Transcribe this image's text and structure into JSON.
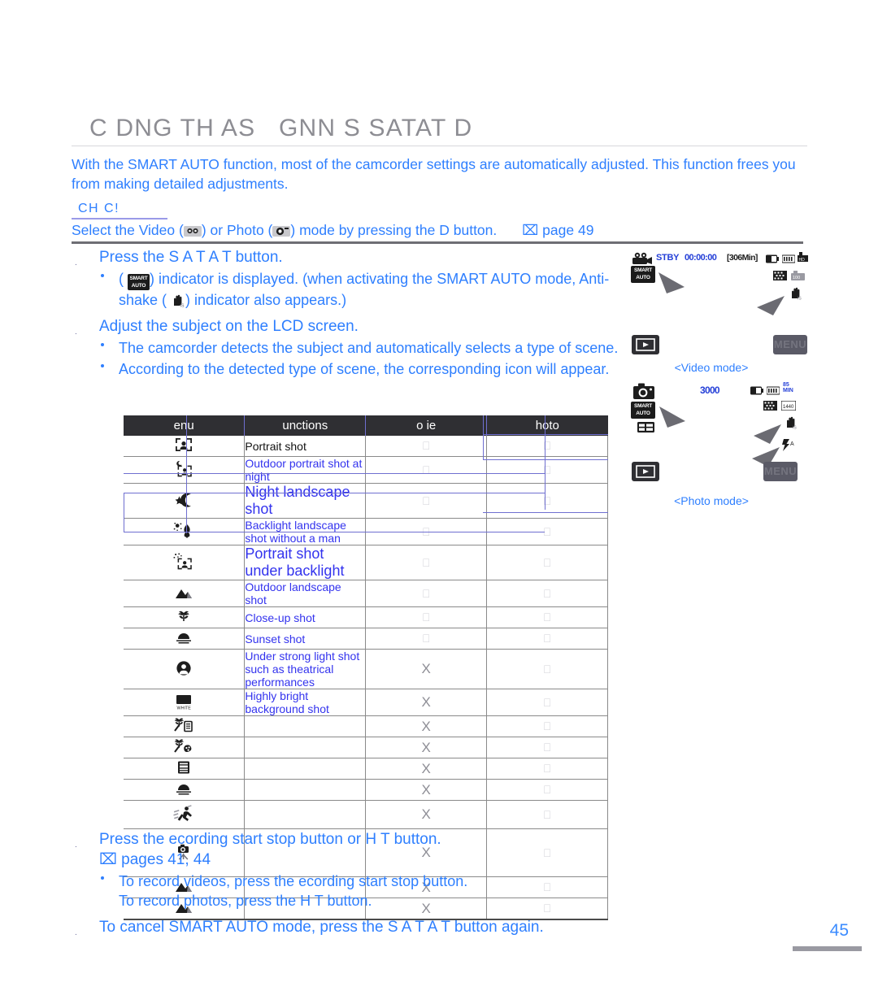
{
  "document": {
    "title": "C DNG TH AS   GNN S SATAT D",
    "page_number": "45"
  },
  "intro": {
    "paragraph": "With the SMART AUTO function, most of the camcorder settings are automatically adjusted. This function frees you from making detailed adjustments."
  },
  "check_box": {
    "label": "CH C!",
    "line_part1": "Select the Video (",
    "line_part2": ") or Photo (",
    "line_part3": ") mode by pressing the  D  button.",
    "page_ref": "⌧ page 49"
  },
  "steps": [
    {
      "num": ".",
      "text": "Press the S A T A T  button.",
      "bullets": [
        {
          "pre": "(",
          "mid": ") indicator is displayed. (when activating the SMART AUTO mode, Anti-shake (",
          "post": ") indicator also appears.)"
        }
      ]
    },
    {
      "num": ".",
      "text": "Adjust the subject on the LCD screen.",
      "bullets": [
        {
          "plain": "The camcorder detects the subject and automatically selects a type of scene."
        },
        {
          "plain": "According to the detected type of scene, the corresponding icon will appear."
        }
      ]
    }
  ],
  "steps_bottom": [
    {
      "num": ".",
      "text": "Press the  ecording start stop button or  H T  button.",
      "ref": "⌧ pages 41, 44",
      "bullets": [
        {
          "plain": "To record videos, press the  ecording start stop button."
        },
        {
          "plain": "To record photos, press the  H T  button."
        }
      ]
    },
    {
      "num": ".",
      "text": "To cancel SMART AUTO mode, press the S A T A T  button again.",
      "ref": "",
      "bullets": []
    }
  ],
  "table": {
    "headers": {
      "menu": "enu",
      "functions": "unctions",
      "movie": "o ie",
      "photo": "hoto"
    },
    "rows": [
      {
        "icon": "portrait-frame-icon",
        "function": "Portrait shot",
        "movie": "⎕",
        "photo": "⎕",
        "black": true
      },
      {
        "icon": "night-portrait-icon",
        "function": "Outdoor portrait shot at night",
        "movie": "⎕",
        "photo": "⎕"
      },
      {
        "icon": "night-landscape-icon",
        "function": "Night landscape shot",
        "movie": "⎕",
        "photo": "⎕",
        "big": true
      },
      {
        "icon": "backlight-landscape-icon",
        "function": "Backlight landscape shot without a man",
        "movie": "⎕",
        "photo": "⎕"
      },
      {
        "icon": "backlight-portrait-icon",
        "function": "Portrait shot under backlight",
        "movie": "⎕",
        "photo": "⎕",
        "big": true
      },
      {
        "icon": "outdoor-landscape-icon",
        "function": "Outdoor landscape shot",
        "movie": "⎕",
        "photo": "⎕"
      },
      {
        "icon": "close-up-tulip-icon",
        "function": "Close-up shot",
        "movie": "⎕",
        "photo": "⎕"
      },
      {
        "icon": "sunset-icon",
        "function": "Sunset shot",
        "movie": "⎕",
        "photo": "⎕"
      },
      {
        "icon": "spotlight-icon",
        "function": "Under strong light shot such as theatrical performances",
        "movie": "X",
        "photo": "⎕"
      },
      {
        "icon": "white-background-icon",
        "function": "Highly bright background shot",
        "movie": "X",
        "photo": "⎕"
      },
      {
        "icon": "macro-text-icon",
        "function": "",
        "movie": "X",
        "photo": "⎕"
      },
      {
        "icon": "macro-color-icon",
        "function": "",
        "movie": "X",
        "photo": "⎕"
      },
      {
        "icon": "text-document-icon",
        "function": "",
        "movie": "X",
        "photo": "⎕"
      },
      {
        "icon": "sunset-alt-icon",
        "function": "",
        "movie": "X",
        "photo": "⎕"
      },
      {
        "icon": "action-motion-icon",
        "function": "",
        "movie": "X",
        "photo": "⎕"
      },
      {
        "icon": "tripod-icon",
        "function": "",
        "movie": "X",
        "photo": "⎕",
        "tall": true
      },
      {
        "icon": "landscape-icon",
        "function": "",
        "movie": "X",
        "photo": "⎕"
      },
      {
        "icon": "landscape-icon-2",
        "function": "",
        "movie": "X",
        "photo": "⎕"
      }
    ]
  },
  "illustrations": {
    "video": {
      "caption": "<Video mode>",
      "stby": "STBY",
      "timecode": "00:00:00",
      "remaining": "[306Min]",
      "smart_top": "SMART",
      "smart_bottom": "AUTO",
      "menu_label": "MENU"
    },
    "photo": {
      "caption": "<Photo mode>",
      "counter": "3000",
      "smart_top": "SMART",
      "smart_bottom": "AUTO",
      "menu_label": "MENU",
      "min_label": "MIN"
    }
  },
  "colors": {
    "body_blue": "#2E7FFF",
    "table_blue": "#3333EE",
    "title_gray": "#8d8d93",
    "header_bg": "#2f2f33",
    "overlay_blue": "#6f6fd0"
  }
}
